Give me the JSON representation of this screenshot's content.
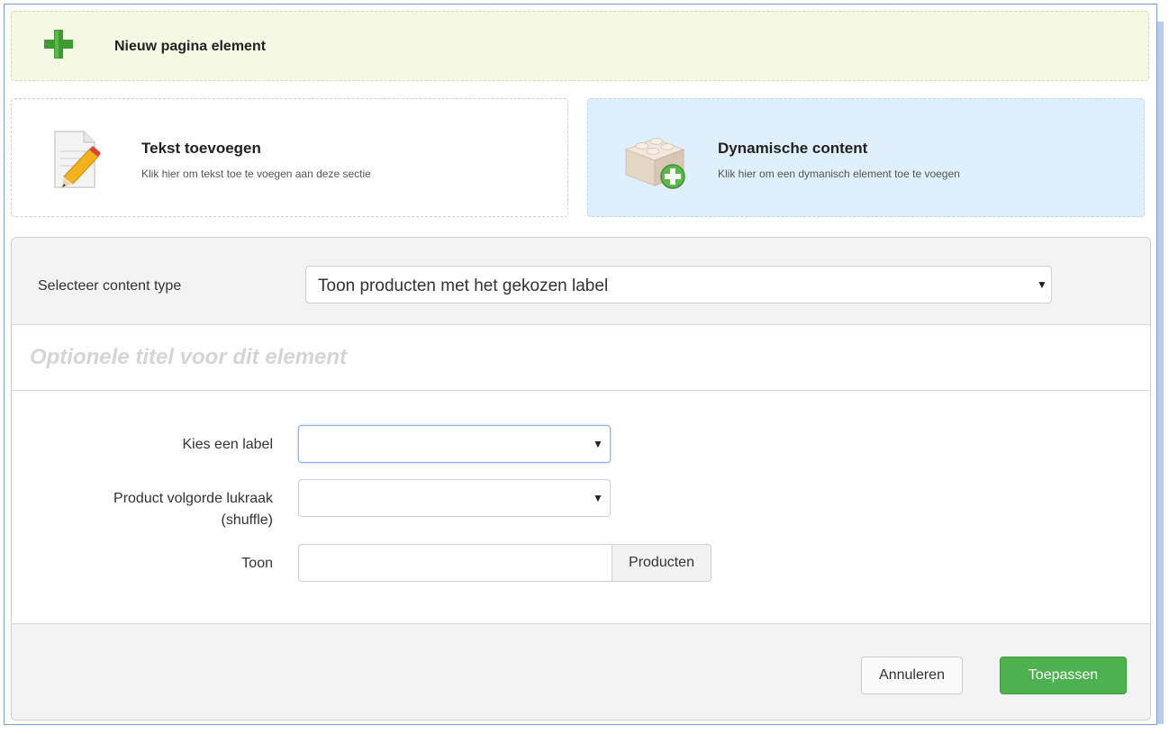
{
  "header": {
    "title": "Nieuw pagina element"
  },
  "cards": {
    "text": {
      "title": "Tekst toevoegen",
      "description": "Klik hier om tekst toe te voegen aan deze sectie"
    },
    "dynamic": {
      "title": "Dynamische content",
      "description": "Klik hier om een dymanisch element toe te voegen"
    }
  },
  "content_type": {
    "label": "Selecteer content type",
    "selected": "Toon producten met het gekozen label"
  },
  "element_title": {
    "placeholder": "Optionele titel voor dit element",
    "value": ""
  },
  "form": {
    "label_field": {
      "label": "Kies een label",
      "selected": ""
    },
    "shuffle_field": {
      "label_line1": "Product volgorde lukraak",
      "label_line2": "(shuffle)",
      "selected": ""
    },
    "toon_field": {
      "label": "Toon",
      "value": "",
      "addon": "Producten"
    }
  },
  "buttons": {
    "cancel": "Annuleren",
    "apply": "Toepassen"
  },
  "colors": {
    "header_bg": "#f5f9e4",
    "dynamic_card_bg": "#dfeffb",
    "apply_button": "#4db14f",
    "window_border": "#7aa0d2"
  }
}
